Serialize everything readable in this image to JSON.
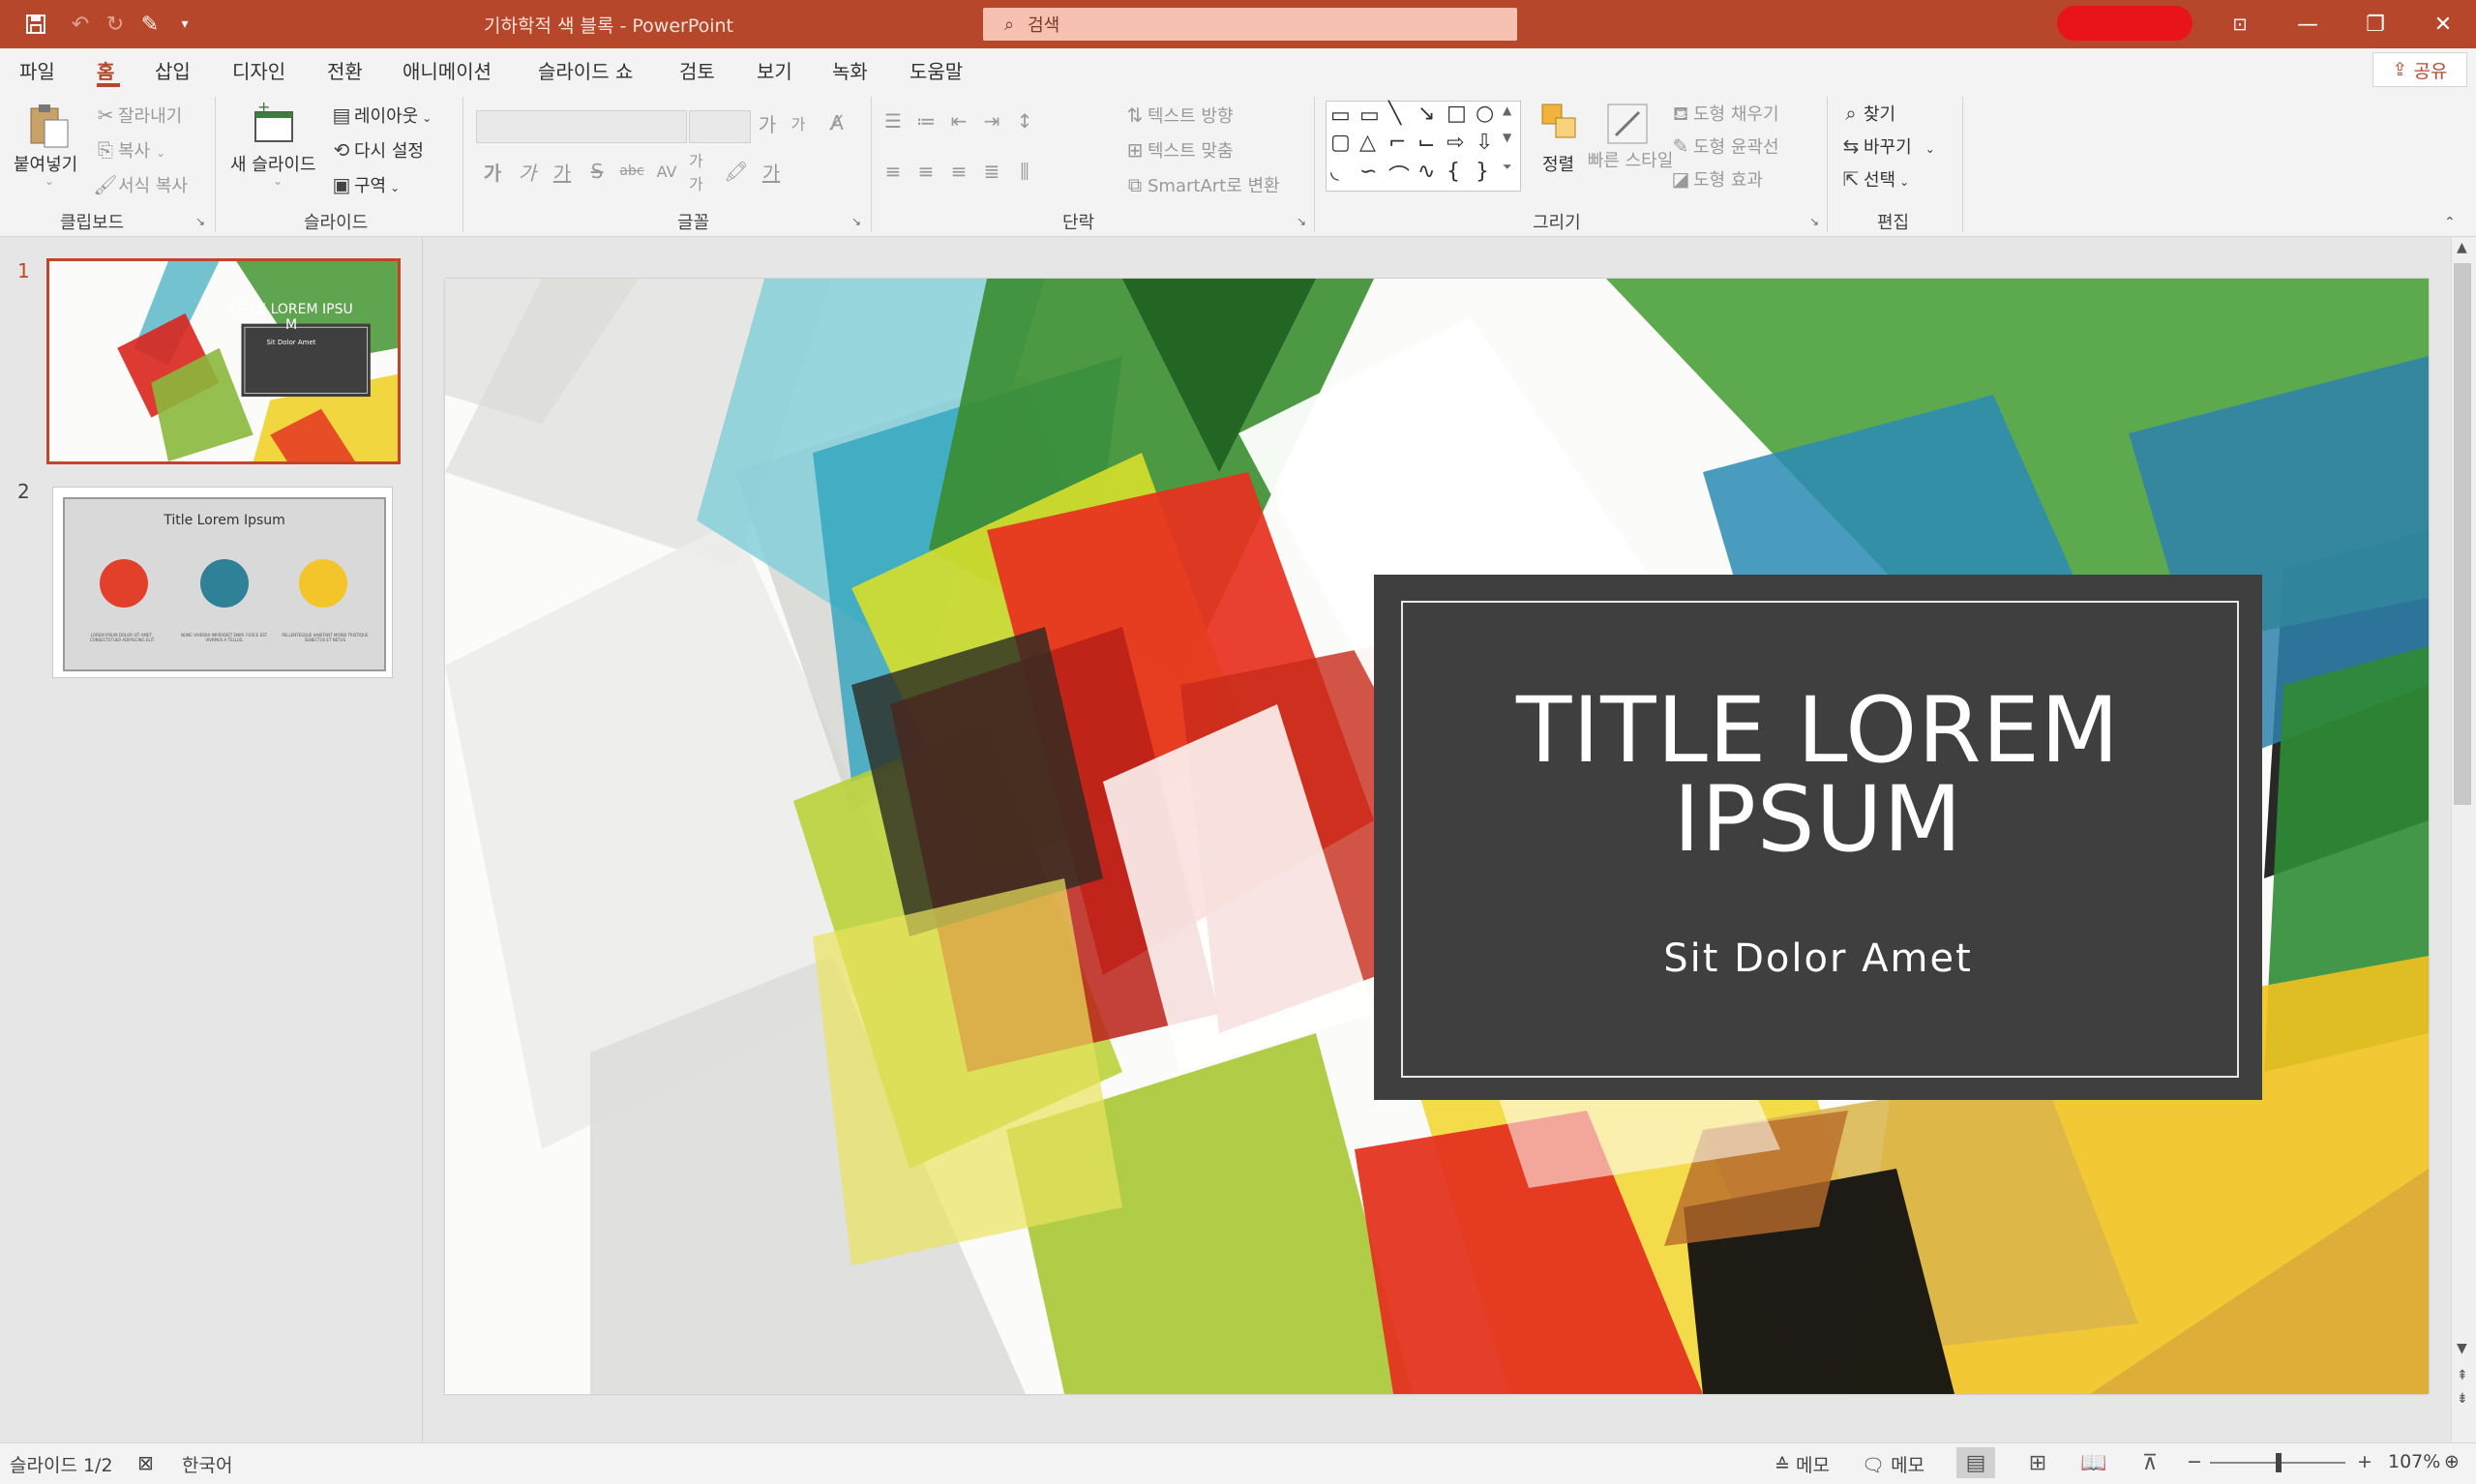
{
  "titlebar": {
    "title": "기하학적 색 블록  -  PowerPoint",
    "search_placeholder": "검색",
    "minimize": "—",
    "restore": "❐",
    "close": "✕"
  },
  "tabs": [
    "파일",
    "홈",
    "삽입",
    "디자인",
    "전환",
    "애니메이션",
    "슬라이드 쇼",
    "검토",
    "보기",
    "녹화",
    "도움말"
  ],
  "active_tab": "홈",
  "share_label": "공유",
  "ribbon": {
    "clipboard": {
      "group": "클립보드",
      "paste": "붙여넣기",
      "cut": "잘라내기",
      "copy": "복사",
      "format_painter": "서식 복사"
    },
    "slides": {
      "group": "슬라이드",
      "new_slide": "새 슬라이드",
      "layout": "레이아웃",
      "reset": "다시 설정",
      "section": "구역"
    },
    "font": {
      "group": "글꼴",
      "bold": "가",
      "italic": "가",
      "underline": "가",
      "strike": "S",
      "spacing": "AV",
      "case": "가가",
      "grow": "가",
      "shrink": "가",
      "color": "가"
    },
    "paragraph": {
      "group": "단락",
      "text_direction": "텍스트 방향",
      "text_align": "텍스트 맞춤",
      "smartart": "SmartArt로 변환"
    },
    "drawing": {
      "group": "그리기",
      "arrange": "정렬",
      "quick_styles": "빠른 스타일",
      "fill": "도형 채우기",
      "outline": "도형 윤곽선",
      "effects": "도형 효과"
    },
    "editing": {
      "group": "편집",
      "find": "찾기",
      "replace": "바꾸기",
      "select": "선택"
    }
  },
  "slides": [
    {
      "number": "1",
      "title": "TITLE LOREM IPSU M",
      "subtitle": "Sit Dolor Amet"
    },
    {
      "number": "2",
      "title": "Title Lorem Ipsum",
      "captions": [
        "LOREM IPSUM DOLOR SIT AMET, CONSECTETUER ADIPISCING ELIT",
        "NUNC VIVERRA IMPERDIET ENIM. FUSCE EST. VIVAMUS A TELLUS.",
        "PELLENTESQUE HABITANT MORBI TRISTIQUE SENECTUS ET NETUS"
      ]
    }
  ],
  "main_slide": {
    "title": "TITLE LOREM IPSUM",
    "subtitle": "Sit Dolor Amet"
  },
  "status": {
    "slide_count": "슬라이드 1/2",
    "language": "한국어",
    "notes": "메모",
    "comments": "메모",
    "zoom": "107%"
  },
  "colors": {
    "accent": "#b7472a",
    "titlebar": "#b7472a",
    "title_box": "#3f3f3f"
  }
}
